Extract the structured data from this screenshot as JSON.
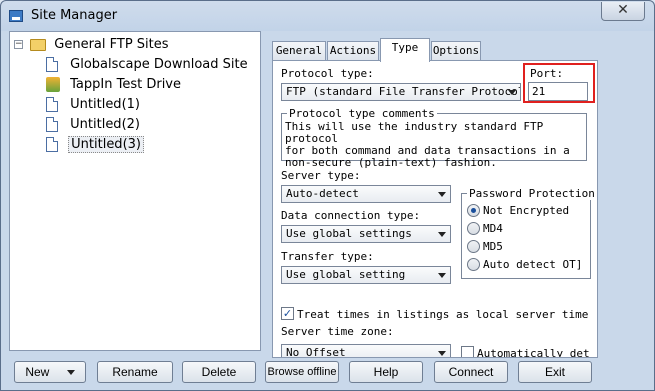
{
  "window": {
    "title": "Site Manager",
    "close_glyph": "✕"
  },
  "tree": {
    "root": {
      "label": "General FTP Sites",
      "expander": "−"
    },
    "items": [
      {
        "label": "Globalscape Download Site",
        "icon": "document-icon"
      },
      {
        "label": "TappIn Test Drive",
        "icon": "tappin-icon"
      },
      {
        "label": "Untitled(1)",
        "icon": "document-icon"
      },
      {
        "label": "Untitled(2)",
        "icon": "document-icon"
      },
      {
        "label": "Untitled(3)",
        "icon": "document-icon",
        "selected": true
      }
    ]
  },
  "tabs": [
    {
      "label": "General"
    },
    {
      "label": "Actions"
    },
    {
      "label": "Type",
      "active": true
    },
    {
      "label": "Options"
    }
  ],
  "type_tab": {
    "protocol_type_label": "Protocol type:",
    "protocol_value": "FTP (standard File Transfer Protocol",
    "port_label": "Port:",
    "port_value": "21",
    "comments_label": "Protocol type comments",
    "comments_lines": [
      "This will use the industry standard FTP protocol",
      "for both command and data transactions in a",
      "non-secure (plain-text) fashion."
    ],
    "server_type_label": "Server type:",
    "server_type_value": "Auto-detect",
    "data_conn_label": "Data connection type:",
    "data_conn_value": "Use global settings",
    "transfer_type_label": "Transfer type:",
    "transfer_type_value": "Use global setting",
    "password_group_label": "Password Protection",
    "password_options": [
      {
        "label": "Not Encrypted",
        "selected": true
      },
      {
        "label": "MD4",
        "selected": false
      },
      {
        "label": "MD5",
        "selected": false
      },
      {
        "label": "Auto detect OT]",
        "selected": false
      }
    ],
    "treat_times_label": "Treat times in listings as local server time",
    "treat_times_checked": true,
    "server_time_zone_label": "Server time zone:",
    "time_zone_value": "No Offset",
    "auto_det_label": "Automatically det"
  },
  "buttons": {
    "new": "New",
    "rename": "Rename",
    "delete": "Delete",
    "browse_offline": "Browse offline",
    "help": "Help",
    "connect": "Connect",
    "exit": "Exit"
  },
  "colors": {
    "highlight_border": "#e0201e",
    "selection_dot": "#1a4f9c"
  }
}
